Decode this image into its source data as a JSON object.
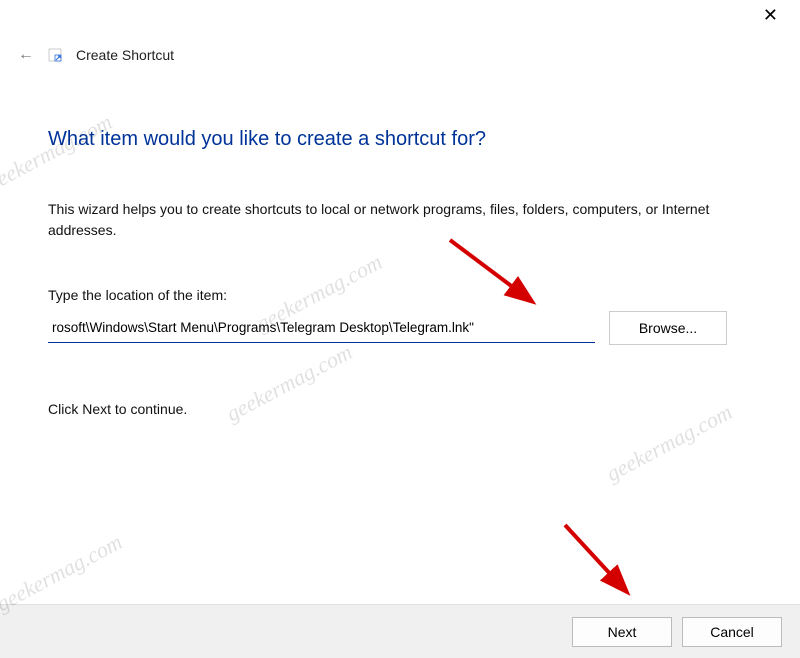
{
  "header": {
    "title": "Create Shortcut"
  },
  "main": {
    "heading": "What item would you like to create a shortcut for?",
    "description": "This wizard helps you to create shortcuts to local or network programs, files, folders, computers, or Internet addresses.",
    "field_label": "Type the location of the item:",
    "path_value": "rosoft\\Windows\\Start Menu\\Programs\\Telegram Desktop\\Telegram.lnk\"",
    "browse_label": "Browse...",
    "continue_text": "Click Next to continue."
  },
  "footer": {
    "next_label": "Next",
    "cancel_label": "Cancel"
  },
  "watermark": "geekermag.com"
}
